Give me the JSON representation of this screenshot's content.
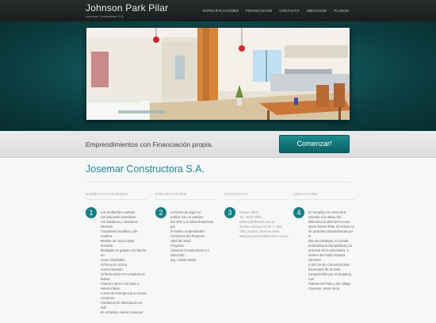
{
  "header": {
    "title": "Johnson Park Pilar",
    "subtitle": "Josemar Constructora S.A.",
    "nav": [
      "ESPECIFICACIONES",
      "FINANCIACIÓN",
      "CONTACTO",
      "UBICACIÓN",
      "PLANOS"
    ]
  },
  "promo": {
    "text": "Emprendimientos con Financiación propia.",
    "button": "Comenzar!"
  },
  "main": {
    "title": "Josemar Constructora S.A.",
    "columns": [
      {
        "heading": "ESPECIFICACIONES",
        "number": "1",
        "text": "Los ambientes cuentan\ncon placards corredizos\ncon bauleras y divisiones internas.\nCarpintería metálica y de madera.\nMueble de cocina bajo mesada.\nMesadas en granito con bacha en\nacero inoxidable.\nGrifería de cocina monocomando.\nGrifería artica FV completa en\nbaños.\nPintura interior con látex y\nexterior látex.\nLuces de emergencia en áreas\ncomunes.\nArtefactos de iluminación en hall\nde entrada y áreas comunes."
      },
      {
        "heading": "FINANCIACIÓN",
        "number": "2",
        "text": "La forma de pago se\nrealiza con un anticipo\ndel 40% y el saldo financiado por\nel mismo emprendedor.\nComienzo del Proyecto\nAbril del 2012.\nProyecto:\nJosemar Constructora S.A.\nDirección:\nIng. Carlos Sardri"
      },
      {
        "heading": "CONTACTO",
        "number": "3",
        "text": "Roque Alfaro\nTel: 4542-3005\ncallsoxi@fibertel.com.ar\nTomas Lebreton 5130 1º piso\nVilla Urquiza, Buenos Aires\nwww.josemarconstructora.com.ar"
      },
      {
        "heading": "UBICACIÓN",
        "number": "4",
        "text": "El complejo se encuentra\nubicado a la altura del\nkilómetro 52,500 del Acceso\nNorte Ramal Pilar. El mismo es\nde grandes características por el\nsitio de privilegio, en donde\npredomina la tranquilidad y la\narmonía de la naturaleza. A\nmetros del Hotel Howard Johnson\ny del Centro Comercial mas\nimportante de la zona\ncomprendido por el shopping Las\nPalmas del Pilar y los Village\nCinemas, entre otros."
      }
    ]
  },
  "colors": {
    "accent": "#147e84",
    "header_bg": "#1f2122",
    "hero_bg": "#12585b"
  }
}
